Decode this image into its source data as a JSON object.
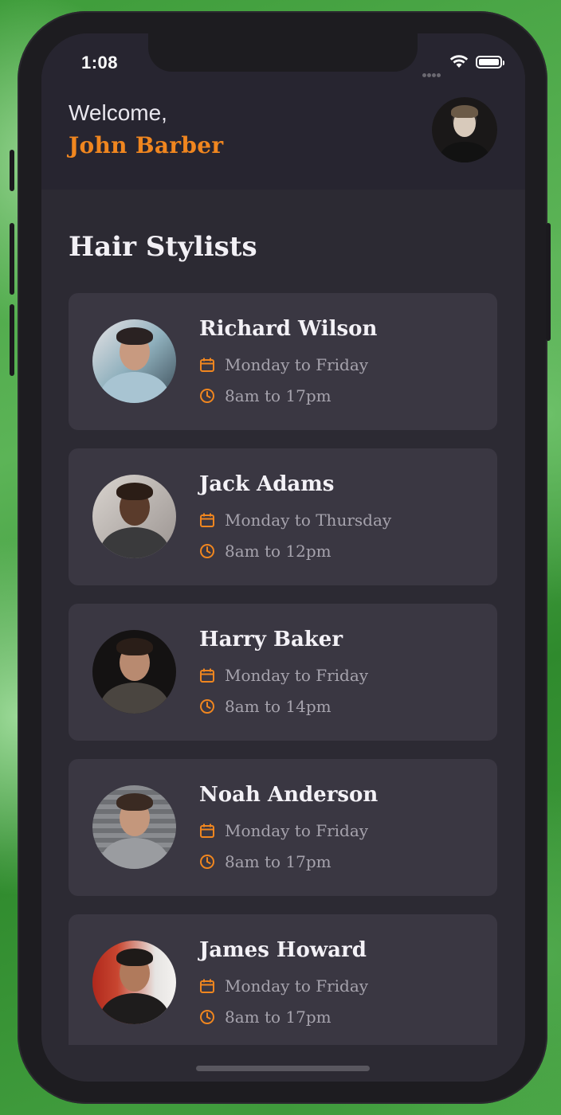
{
  "status_bar": {
    "time": "1:08"
  },
  "header": {
    "welcome": "Welcome,",
    "user_name": "John Barber"
  },
  "section": {
    "title": "Hair Stylists"
  },
  "stylists": [
    {
      "name": "Richard Wilson",
      "days": "Monday to Friday",
      "hours": "8am to 17pm"
    },
    {
      "name": "Jack Adams",
      "days": "Monday to Thursday",
      "hours": "8am to 12pm"
    },
    {
      "name": "Harry Baker",
      "days": "Monday to Friday",
      "hours": "8am to 14pm"
    },
    {
      "name": "Noah Anderson",
      "days": "Monday to Friday",
      "hours": "8am to 17pm"
    },
    {
      "name": "James Howard",
      "days": "Monday to Friday",
      "hours": "8am to 17pm"
    }
  ],
  "colors": {
    "accent": "#f0861f",
    "card": "#3a3742",
    "background": "#2c2a33"
  },
  "icons": {
    "days": "calendar-icon",
    "hours": "clock-icon"
  }
}
